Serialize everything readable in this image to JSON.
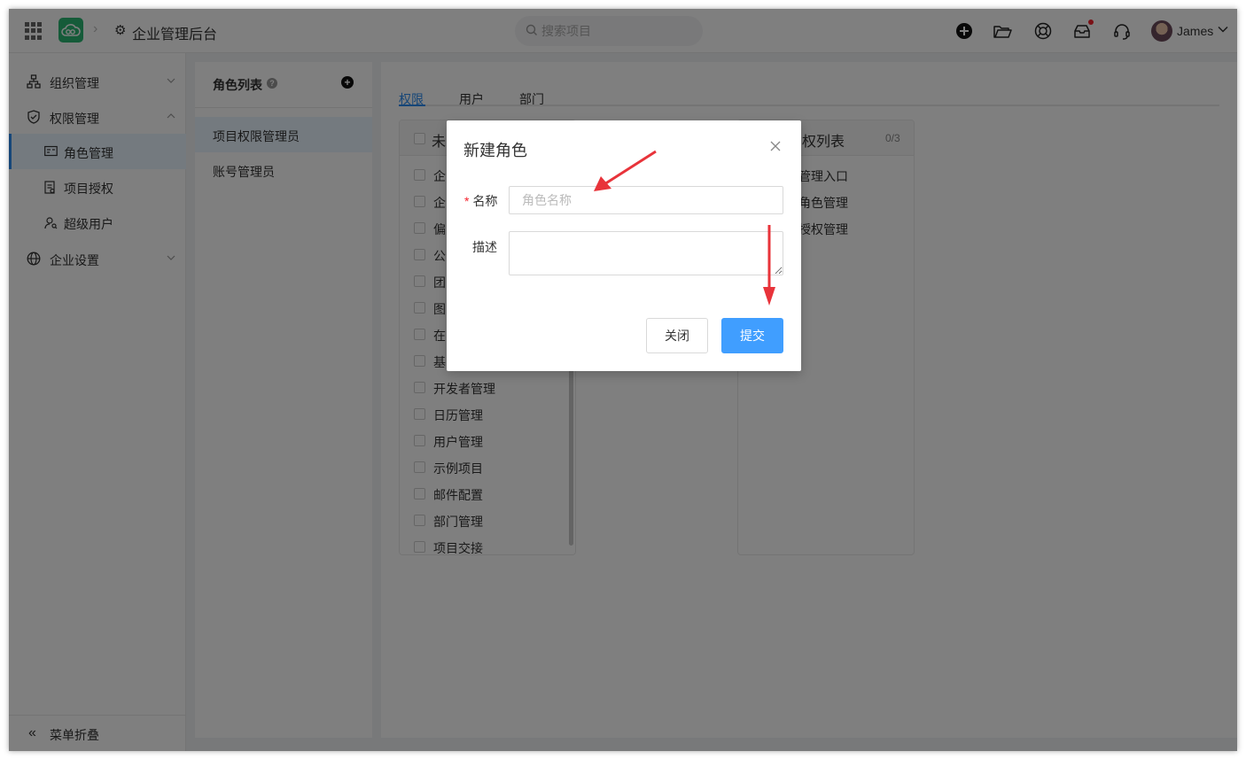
{
  "header": {
    "app_title": "企业管理后台",
    "search_placeholder": "搜索项目",
    "user_name": "James"
  },
  "sidebar": {
    "items": [
      {
        "label": "组织管理",
        "icon": "org-chart-icon",
        "expanded": false
      },
      {
        "label": "权限管理",
        "icon": "shield-icon",
        "expanded": true,
        "children": [
          {
            "label": "角色管理",
            "icon": "id-card-icon",
            "active": true
          },
          {
            "label": "项目授权",
            "icon": "doc-auth-icon"
          },
          {
            "label": "超级用户",
            "icon": "user-key-icon"
          }
        ]
      },
      {
        "label": "企业设置",
        "icon": "globe-icon",
        "expanded": false
      }
    ],
    "collapse_label": "菜单折叠"
  },
  "role_panel": {
    "title": "角色列表",
    "roles": [
      "项目权限管理员",
      "账号管理员"
    ]
  },
  "main": {
    "tabs": [
      "权限",
      "用户",
      "部门"
    ],
    "active_tab": "权限",
    "left_box": {
      "title_visible": "未",
      "items": [
        "企",
        "企",
        "偏",
        "公",
        "团",
        "图",
        "在",
        "基",
        "开发者管理",
        "日历管理",
        "用户管理",
        "示例项目",
        "邮件配置",
        "部门管理",
        "项目交接"
      ]
    },
    "right_box": {
      "title_visible": "权列表",
      "count": "0/3",
      "items": [
        "管理入口",
        "角色管理",
        "授权管理"
      ]
    }
  },
  "modal": {
    "title": "新建角色",
    "name_label": "名称",
    "name_placeholder": "角色名称",
    "desc_label": "描述",
    "close_button": "关闭",
    "submit_button": "提交"
  },
  "colors": {
    "primary": "#409eff",
    "tab_active": "#2c8cf0",
    "logo": "#2bb673",
    "required": "#f5222d",
    "annotation_arrow": "#e8333a"
  }
}
